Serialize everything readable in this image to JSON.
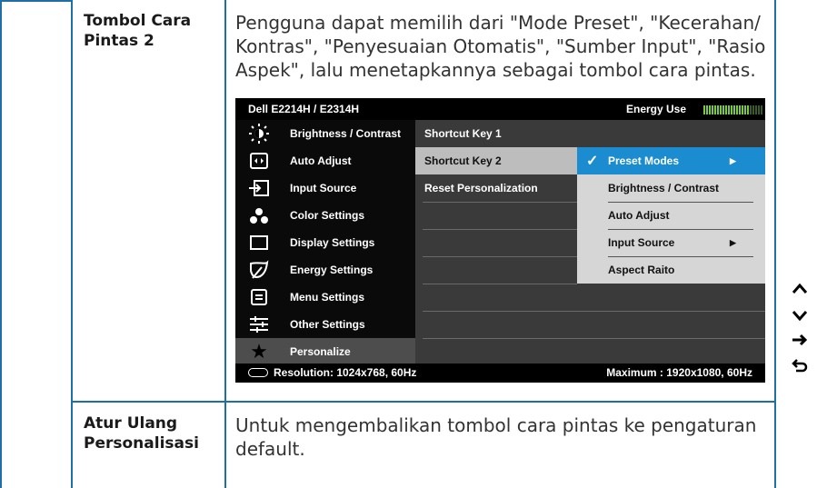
{
  "rows": [
    {
      "label_line1": "Tombol Cara",
      "label_line2": "Pintas 2",
      "desc_lines": [
        "Pengguna dapat memilih dari \"Mode Preset\", \"Kecerahan/",
        "Kontras\", \"Penyesuaian Otomatis\", \"Sumber Input\", \"Rasio",
        "Aspek\", lalu menetapkannya sebagai tombol cara pintas."
      ]
    },
    {
      "label_line1": "Atur Ulang",
      "label_line2": "Personalisasi",
      "desc_lines": [
        "Untuk mengembalikan tombol cara pintas ke pengaturan",
        "default."
      ]
    }
  ],
  "osd": {
    "title": "Dell E2214H / E2314H",
    "energy_label": "Energy Use",
    "energy_level": 0.75,
    "energy_color": "#7ac943",
    "menu": [
      {
        "icon": "brightness-icon",
        "label": "Brightness / Contrast"
      },
      {
        "icon": "auto-adjust-icon",
        "label": "Auto Adjust"
      },
      {
        "icon": "input-source-icon",
        "label": "Input Source"
      },
      {
        "icon": "color-settings-icon",
        "label": "Color Settings"
      },
      {
        "icon": "display-settings-icon",
        "label": "Display Settings"
      },
      {
        "icon": "energy-settings-icon",
        "label": "Energy Settings"
      },
      {
        "icon": "menu-settings-icon",
        "label": "Menu Settings"
      },
      {
        "icon": "other-settings-icon",
        "label": "Other Settings"
      },
      {
        "icon": "star-icon",
        "label": "Personalize"
      }
    ],
    "submenu": [
      "Shortcut Key 1",
      "Shortcut Key 2",
      "Reset Personalization"
    ],
    "options": [
      "Preset Modes",
      "Brightness / Contrast",
      "Auto Adjust",
      "Input Source",
      "Aspect Raito"
    ],
    "selected_option_color": "#1a8ccf",
    "footer_left": "Resolution: 1024x768,  60Hz",
    "footer_right": "Maximum : 1920x1080,  60Hz"
  },
  "nav_buttons": [
    {
      "icon": "up-arrow-icon",
      "glyph": "^"
    },
    {
      "icon": "down-arrow-icon",
      "glyph": "v"
    },
    {
      "icon": "right-arrow-icon",
      "glyph": "→"
    },
    {
      "icon": "back-icon",
      "glyph": "↩"
    }
  ]
}
